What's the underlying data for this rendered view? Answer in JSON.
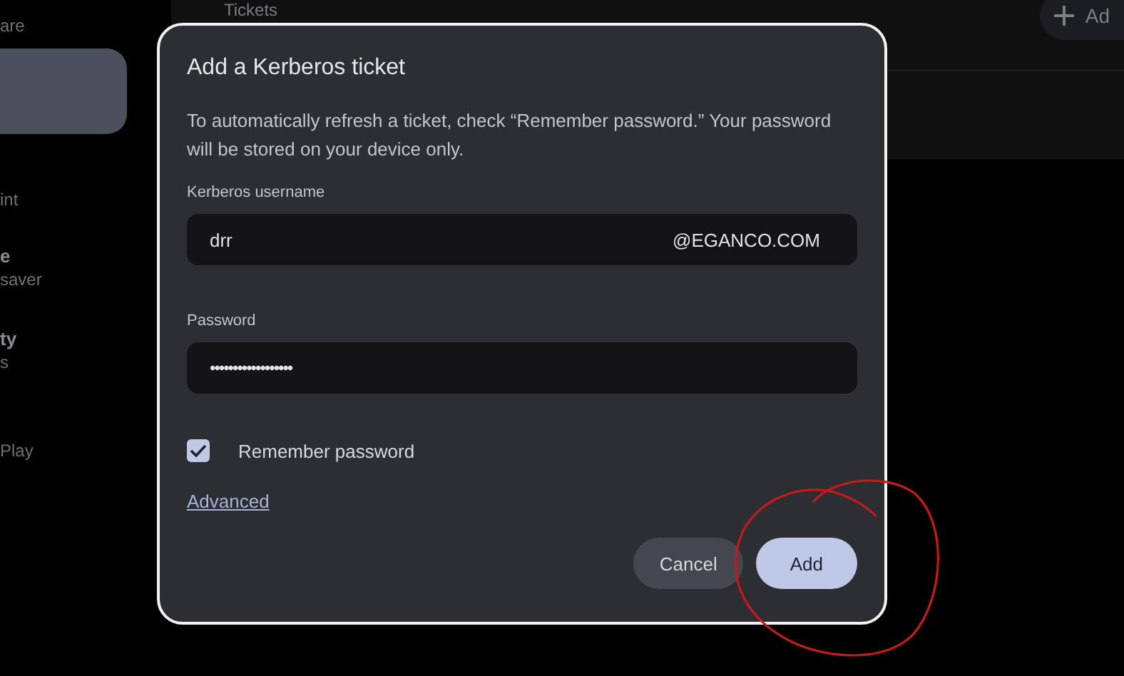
{
  "sidebar": {
    "items": [
      {
        "label": "are",
        "selected": false,
        "bold": false
      },
      {
        "selected": true
      },
      {
        "label": "int",
        "selected": false,
        "bold": false
      },
      {
        "label": "e",
        "selected": false,
        "bold": true
      },
      {
        "label": "saver",
        "selected": false,
        "bold": false
      },
      {
        "label": "ty",
        "selected": false,
        "bold": true
      },
      {
        "label": "s",
        "selected": false,
        "bold": false
      },
      {
        "label": "Play",
        "selected": false,
        "bold": false
      }
    ]
  },
  "main": {
    "title": "Tickets",
    "add_button": "Ad"
  },
  "dialog": {
    "title": "Add a Kerberos ticket",
    "description": "To automatically refresh a ticket, check “Remember password.” Your password will be stored on your device only.",
    "username": {
      "label": "Kerberos username",
      "value": "drr",
      "suffix": "@EGANCO.COM"
    },
    "password": {
      "label": "Password",
      "value": "••••••••••••••••••"
    },
    "remember": {
      "label": "Remember password",
      "checked": true
    },
    "advanced_link": "Advanced",
    "buttons": [
      {
        "label": "Cancel",
        "kind": "secondary"
      },
      {
        "label": "Add",
        "kind": "primary"
      }
    ]
  }
}
